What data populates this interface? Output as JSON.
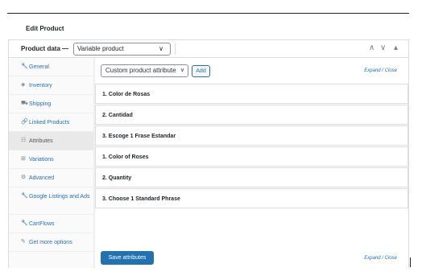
{
  "page": {
    "title": "Edit Product"
  },
  "product_data": {
    "label": "Product data —",
    "type_value": "Variable product",
    "controls": [
      "∧",
      "∨",
      "▴"
    ]
  },
  "tabs": [
    {
      "label": "General",
      "icon": "wrench-icon",
      "glyph": "🔧",
      "active": false
    },
    {
      "label": "Inventory",
      "icon": "tag-icon",
      "glyph": "◈",
      "active": false
    },
    {
      "label": "Shipping",
      "icon": "truck-icon",
      "glyph": "⛟",
      "active": false
    },
    {
      "label": "Linked Products",
      "icon": "link-icon",
      "glyph": "🔗",
      "active": false
    },
    {
      "label": "Attributes",
      "icon": "list-icon",
      "glyph": "☷",
      "active": true
    },
    {
      "label": "Variations",
      "icon": "grid-icon",
      "glyph": "⊞",
      "active": false
    },
    {
      "label": "Advanced",
      "icon": "gear-icon",
      "glyph": "⚙",
      "active": false
    },
    {
      "label": "Google Listings and Ads",
      "icon": "wrench-icon",
      "glyph": "🔧",
      "active": false
    },
    {
      "label": "CartFlows",
      "icon": "wrench-icon",
      "glyph": "🔧",
      "active": false
    },
    {
      "label": "Get more options",
      "icon": "plugin-icon",
      "glyph": "✎",
      "active": false
    }
  ],
  "attributes_panel": {
    "select_value": "Custom product attribute",
    "add_label": "Add",
    "expand_close": "Expand / Close",
    "rows": [
      "1. Color de Rosas",
      "2. Cantidad",
      "3. Escoge 1 Frase Estandar",
      "1. Color of Roses",
      "2. Quantity",
      "3. Choose 1 Standard Phrase"
    ],
    "save_label": "Save attributes"
  },
  "colors": {
    "link": "#2271b1",
    "primary_button": "#2271b1",
    "border": "#dcdcde"
  }
}
